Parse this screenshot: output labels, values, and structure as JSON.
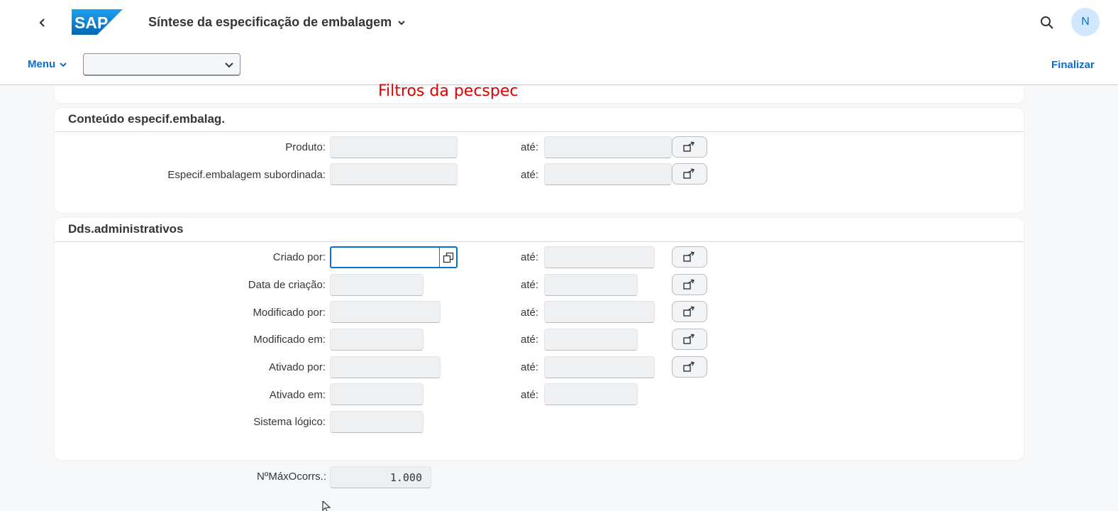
{
  "header": {
    "title": "Síntese da especificação de embalagem",
    "avatar_initial": "N",
    "logo_text": "SAP"
  },
  "toolbar": {
    "menu_label": "Menu",
    "select_value": "",
    "finalize_label": "Finalizar"
  },
  "annotation": {
    "text": "Filtros da pecspec",
    "color": "#e00000"
  },
  "sections": {
    "content": {
      "title": "Conteúdo especif.embalag.",
      "rows": [
        {
          "label": "Produto:",
          "to_label": "até:"
        },
        {
          "label": "Especif.embalagem subordinada:",
          "to_label": "até:"
        }
      ]
    },
    "admin": {
      "title": "Dds.administrativos",
      "rows": [
        {
          "label": "Criado por:",
          "to_label": "até:"
        },
        {
          "label": "Data de criação:",
          "to_label": "até:"
        },
        {
          "label": "Modificado por:",
          "to_label": "até:"
        },
        {
          "label": "Modificado em:",
          "to_label": "até:"
        },
        {
          "label": "Ativado por:",
          "to_label": "até:"
        },
        {
          "label": "Ativado em:",
          "to_label": "até:"
        },
        {
          "label": "Sistema lógico:"
        }
      ]
    }
  },
  "max_occurrences": {
    "label": "NºMáxOcorrs.:",
    "value": "1.000"
  },
  "colors": {
    "accent": "#0a6ed1",
    "avatar_bg": "#d1e8ff"
  },
  "icons": [
    "back-chevron-icon",
    "search-icon",
    "chevron-down-icon",
    "multiple-selection-icon",
    "value-help-icon",
    "mouse-pointer-icon"
  ]
}
